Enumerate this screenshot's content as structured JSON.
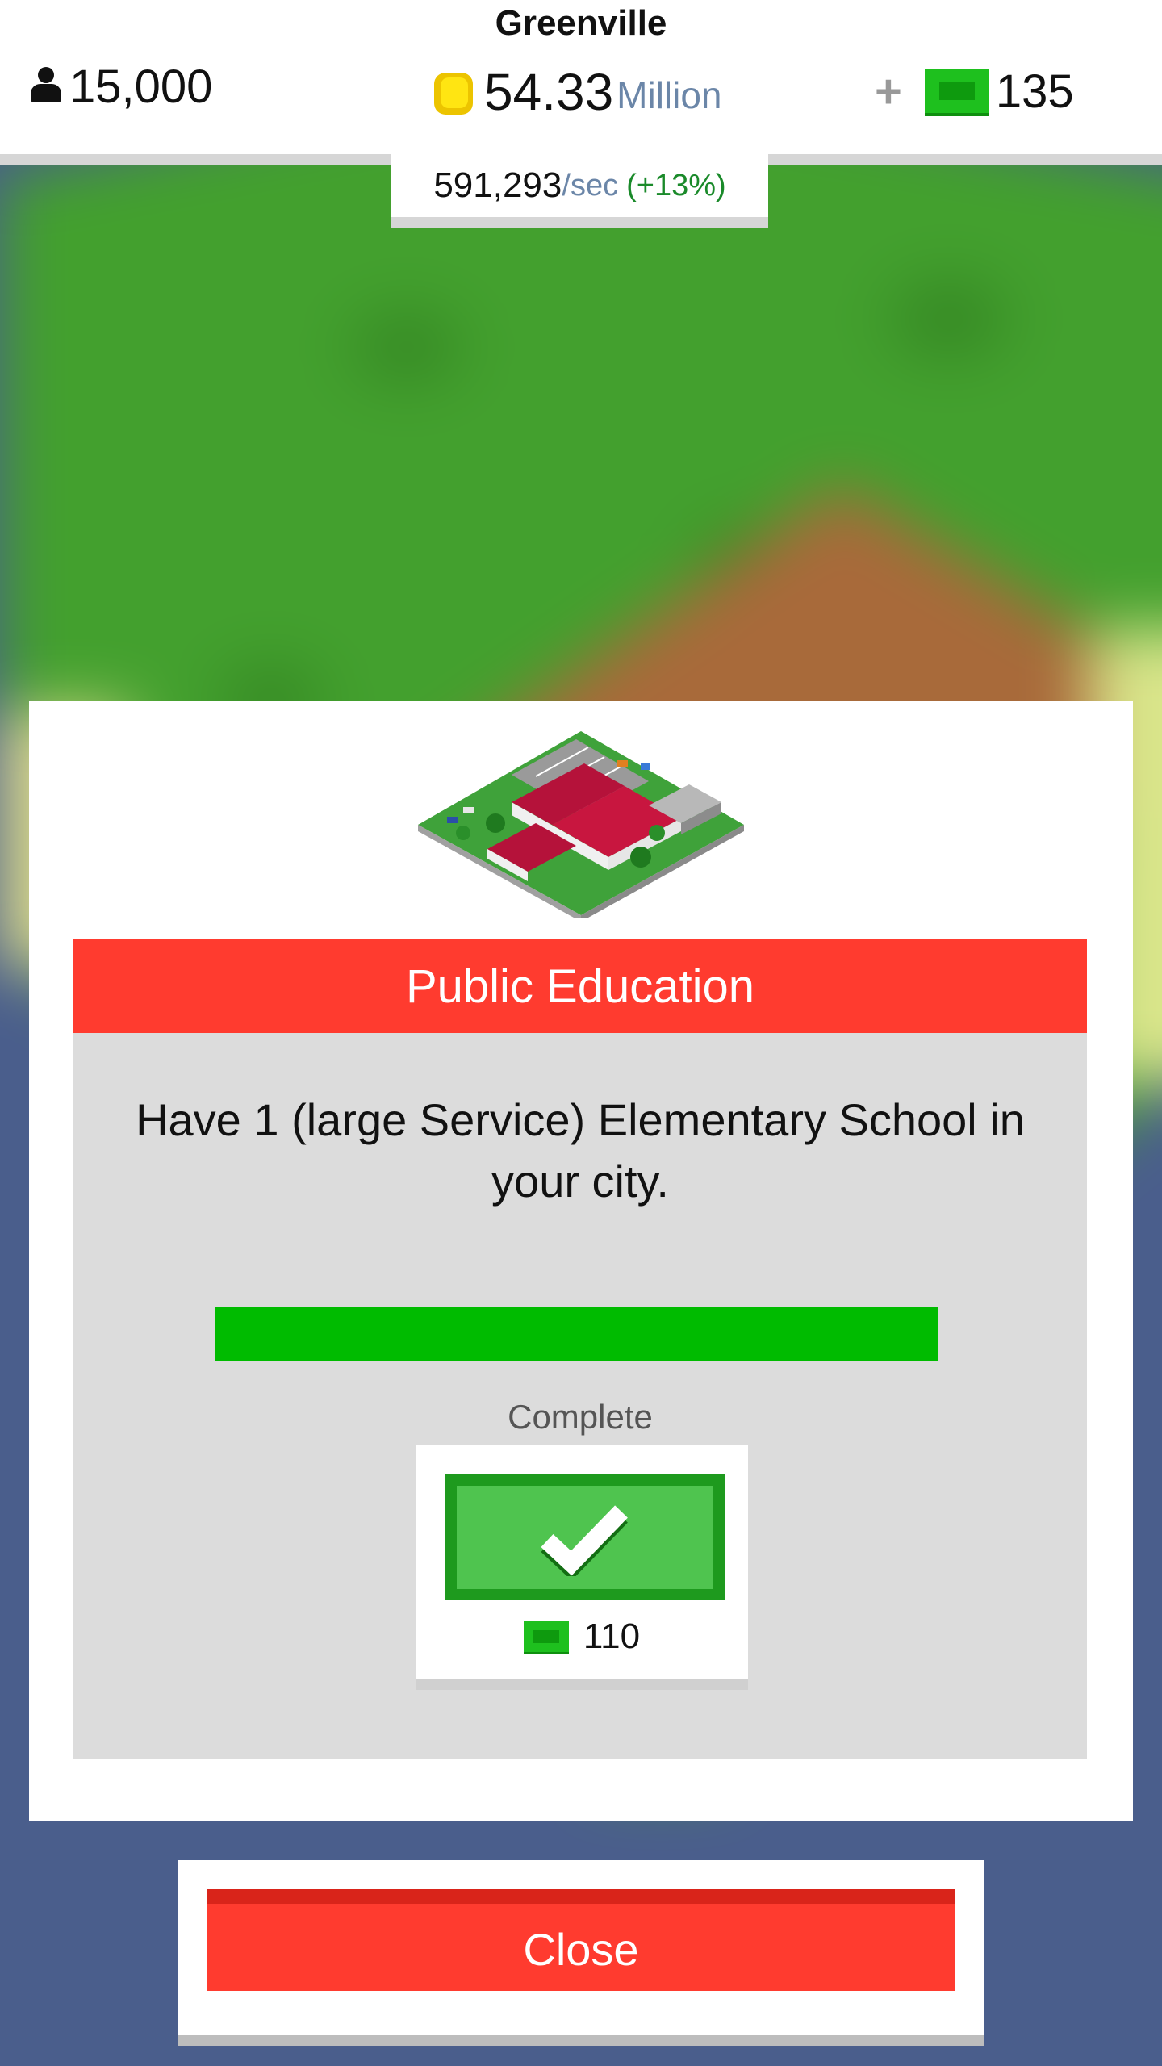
{
  "hud": {
    "city_name": "Greenville",
    "population": "15,000",
    "money_value": "54.33",
    "money_unit": "Million",
    "add_symbol": "+",
    "premium_currency": "135",
    "income_rate": "591,293",
    "income_rate_unit": "/sec",
    "income_bonus": "(+13%)"
  },
  "dialog": {
    "title": "Public Education",
    "description": "Have 1 (large Service) Elementary School in your city.",
    "progress_fraction": 1.0,
    "status": "Complete",
    "reward_amount": "110",
    "building_image": "elementary-school-building"
  },
  "close_label": "Close",
  "colors": {
    "title_bar": "#ff3b2f",
    "progress_fill": "#00bb00",
    "claim_button": "#4fc44f",
    "income_bonus": "#1a8a2a",
    "money_unit": "#6b86a8"
  }
}
